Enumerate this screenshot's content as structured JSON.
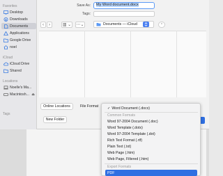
{
  "sidebar": {
    "favorites_title": "Favorites",
    "favorites": [
      {
        "label": "Desktop",
        "icon": "desktop-icon"
      },
      {
        "label": "Downloads",
        "icon": "downloads-icon"
      },
      {
        "label": "Documents",
        "icon": "documents-icon",
        "selected": true
      },
      {
        "label": "Applications",
        "icon": "applications-icon"
      },
      {
        "label": "Google Drive",
        "icon": "google-drive-icon"
      },
      {
        "label": "noel",
        "icon": "home-icon"
      }
    ],
    "icloud_title": "iCloud",
    "icloud": [
      {
        "label": "iCloud Drive",
        "icon": "icloud-drive-icon"
      },
      {
        "label": "Shared",
        "icon": "shared-folder-icon"
      }
    ],
    "locations_title": "Locations",
    "locations": [
      {
        "label": "Noelle's Ma...",
        "icon": "laptop-icon"
      },
      {
        "label": "Macintosh...",
        "icon": "disk-icon"
      }
    ],
    "tags_title": "Tags"
  },
  "form": {
    "save_as_label": "Save As:",
    "save_as_value": "My Word document.docx",
    "tags_label": "Tags:"
  },
  "toolbar": {
    "location": "Documents — iCloud"
  },
  "bottom": {
    "online_locations": "Online Locations",
    "file_format_label": "File Format",
    "new_folder": "New Folder"
  },
  "format_menu": {
    "selected": "Word Document (.docx)",
    "common_header": "Common Formats",
    "common": [
      "Word 97-2004 Document (.doc)",
      "Word Template (.dotx)",
      "Word 97-2004 Template (.dot)",
      "Rich Text Format (.rtf)",
      "Plain Text (.txt)",
      "Web Page (.htm)",
      "Web Page, Filtered (.htm)"
    ],
    "export_header": "Export Formats",
    "export": [
      "PDF"
    ]
  },
  "colors": {
    "accent": "#2f6fe2",
    "selection_highlight": "#b6d4fb"
  }
}
